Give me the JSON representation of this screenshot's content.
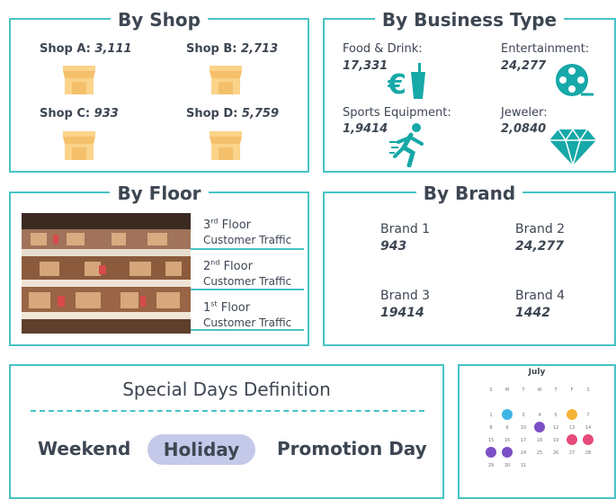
{
  "by_shop": {
    "title": "By Shop",
    "shops": [
      {
        "label": "Shop A:",
        "value": "3,111"
      },
      {
        "label": "Shop B:",
        "value": "2,713"
      },
      {
        "label": "Shop C:",
        "value": "933"
      },
      {
        "label": "Shop D:",
        "value": "5,759"
      }
    ]
  },
  "by_business_type": {
    "title": "By Business Type",
    "items": [
      {
        "label": "Food & Drink:",
        "value": "17,331",
        "icon": "food-drink-icon"
      },
      {
        "label": "Entertainment:",
        "value": "24,277",
        "icon": "film-reel-icon"
      },
      {
        "label": "Sports Equipment:",
        "value": "1,9414",
        "icon": "runner-icon"
      },
      {
        "label": "Jeweler:",
        "value": "2,0840",
        "icon": "diamond-icon"
      }
    ]
  },
  "by_floor": {
    "title": "By Floor",
    "floors": [
      {
        "ordinal": "3",
        "suffix": "rd",
        "word": "Floor",
        "sub": "Customer Traffic"
      },
      {
        "ordinal": "2",
        "suffix": "nd",
        "word": "Floor",
        "sub": "Customer Traffic"
      },
      {
        "ordinal": "1",
        "suffix": "st",
        "word": "Floor",
        "sub": "Customer Traffic"
      }
    ]
  },
  "by_brand": {
    "title": "By Brand",
    "brands": [
      {
        "label": "Brand 1",
        "value": "943"
      },
      {
        "label": "Brand 2",
        "value": "24,277"
      },
      {
        "label": "Brand 3",
        "value": "19414"
      },
      {
        "label": "Brand 4",
        "value": "1442"
      }
    ]
  },
  "special_days": {
    "title": "Special Days Definition",
    "options": [
      "Weekend",
      "Holiday",
      "Promotion Day"
    ],
    "selected": "Holiday"
  },
  "calendar": {
    "month": "July",
    "weekdays": [
      "S",
      "M",
      "T",
      "W",
      "T",
      "F",
      "S"
    ],
    "rows": [
      [
        "",
        "",
        "",
        "",
        "",
        "",
        ""
      ],
      [
        "1",
        "2",
        "3",
        "4",
        "5",
        "6",
        "7"
      ],
      [
        "8",
        "9",
        "10",
        "11",
        "12",
        "13",
        "14"
      ],
      [
        "15",
        "16",
        "17",
        "18",
        "19",
        "20",
        "21"
      ],
      [
        "22",
        "23",
        "24",
        "25",
        "26",
        "27",
        "28"
      ],
      [
        "29",
        "30",
        "31",
        "",
        "",
        "",
        ""
      ]
    ]
  },
  "colors": {
    "accent": "#48c3c4",
    "shop_icon": "#fbd38a",
    "selected_pill": "#c4c9ea"
  }
}
